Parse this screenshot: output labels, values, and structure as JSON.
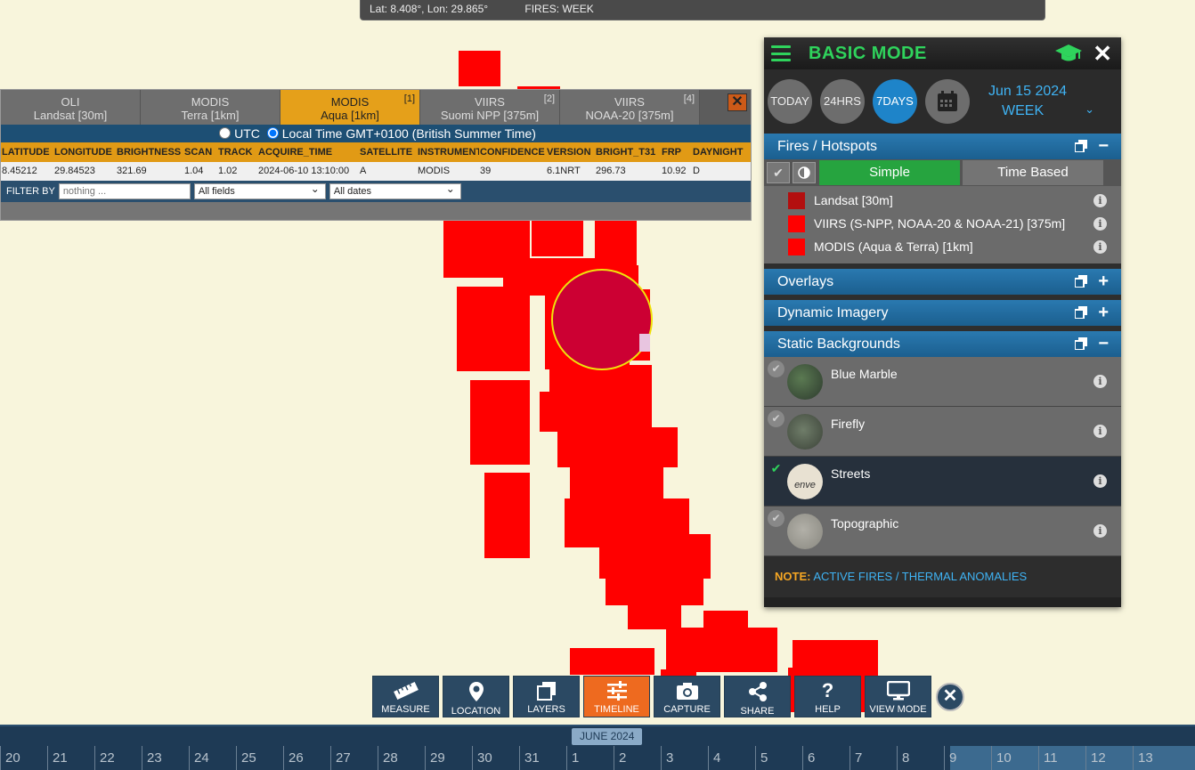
{
  "coords": {
    "position": "Lat: 8.408°, Lon: 29.865°",
    "layer": "FIRES: WEEK"
  },
  "table": {
    "tabs": [
      {
        "line1": "OLI",
        "line2": "Landsat [30m]",
        "count": ""
      },
      {
        "line1": "MODIS",
        "line2": "Terra [1km]",
        "count": ""
      },
      {
        "line1": "MODIS",
        "line2": "Aqua [1km]",
        "count": "[1]"
      },
      {
        "line1": "VIIRS",
        "line2": "Suomi NPP [375m]",
        "count": "[2]"
      },
      {
        "line1": "VIIRS",
        "line2": "NOAA-20 [375m]",
        "count": "[4]"
      }
    ],
    "close_icon": "x-icon",
    "time_utc": "UTC",
    "time_local": "Local Time GMT+0100 (British Summer Time)",
    "columns": [
      "LATITUDE",
      "LONGITUDE",
      "BRIGHTNESS",
      "SCAN",
      "TRACK",
      "ACQUIRE_TIME",
      "SATELLITE",
      "INSTRUMENT",
      "CONFIDENCE",
      "VERSION",
      "BRIGHT_T31",
      "FRP",
      "DAYNIGHT"
    ],
    "row": [
      "8.45212",
      "29.84523",
      "321.69",
      "1.04",
      "1.02",
      "2024-06-10 13:10:00",
      "A",
      "MODIS",
      "39",
      "6.1NRT",
      "296.73",
      "10.92",
      "D"
    ],
    "filter_label": "FILTER BY",
    "filter_placeholder": "nothing ...",
    "field_select": "All fields",
    "date_select": "All dates"
  },
  "panel": {
    "mode": "BASIC MODE",
    "buttons": [
      "TODAY",
      "24HRS",
      "7DAYS"
    ],
    "date": "Jun 15 2024",
    "range": "WEEK",
    "fires_title": "Fires / Hotspots",
    "simple": "Simple",
    "time_based": "Time Based",
    "legend": [
      {
        "label": "Landsat [30m]",
        "color": "#b30f0f"
      },
      {
        "label": "VIIRS (S-NPP, NOAA-20 & NOAA-21) [375m]",
        "color": "#ff0000"
      },
      {
        "label": "MODIS (Aqua & Terra) [1km]",
        "color": "#ff0000"
      }
    ],
    "overlays": "Overlays",
    "dynamic": "Dynamic Imagery",
    "static": "Static Backgrounds",
    "backgrounds": [
      "Blue Marble",
      "Firefly",
      "Streets",
      "Topographic"
    ],
    "thumb_text": "enve",
    "note_label": "NOTE:",
    "note_link": "ACTIVE FIRES / THERMAL ANOMALIES"
  },
  "toolbar": [
    "MEASURE",
    "LOCATION",
    "LAYERS",
    "TIMELINE",
    "CAPTURE",
    "SHARE",
    "HELP",
    "VIEW MODE"
  ],
  "timeline": {
    "month": "JUNE 2024",
    "days": [
      "20",
      "21",
      "22",
      "23",
      "24",
      "25",
      "26",
      "27",
      "28",
      "29",
      "30",
      "31",
      "1",
      "2",
      "3",
      "4",
      "5",
      "6",
      "7",
      "8",
      "9",
      "10",
      "11",
      "12",
      "13"
    ]
  },
  "colors": {
    "fire": "#ff0000",
    "accent_green": "#2fd35c",
    "accent_orange": "#ee6a1f",
    "selected_pixel": "#cc0033"
  }
}
